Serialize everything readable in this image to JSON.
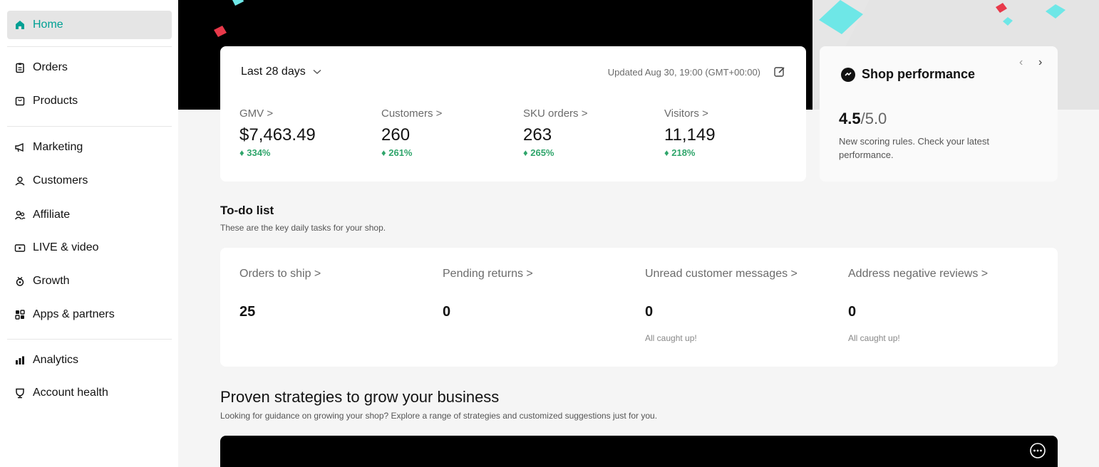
{
  "sidebar": {
    "items": [
      {
        "label": "Home",
        "icon": "home-icon"
      },
      {
        "label": "Orders",
        "icon": "orders-icon"
      },
      {
        "label": "Products",
        "icon": "products-icon"
      },
      {
        "label": "Marketing",
        "icon": "megaphone-icon"
      },
      {
        "label": "Customers",
        "icon": "customers-icon"
      },
      {
        "label": "Affiliate",
        "icon": "affiliate-icon"
      },
      {
        "label": "LIVE & video",
        "icon": "live-video-icon"
      },
      {
        "label": "Growth",
        "icon": "growth-icon"
      },
      {
        "label": "Apps & partners",
        "icon": "apps-icon"
      },
      {
        "label": "Analytics",
        "icon": "analytics-icon"
      },
      {
        "label": "Account health",
        "icon": "account-health-icon"
      }
    ]
  },
  "kpi": {
    "range": "Last 28 days",
    "updated": "Updated Aug 30, 19:00 (GMT+00:00)",
    "metrics": [
      {
        "label": "GMV >",
        "value": "$7,463.49",
        "change": "♦ 334%"
      },
      {
        "label": "Customers >",
        "value": "260",
        "change": "♦ 261%"
      },
      {
        "label": "SKU orders >",
        "value": "263",
        "change": "♦ 265%"
      },
      {
        "label": "Visitors >",
        "value": "11,149",
        "change": "♦ 218%"
      }
    ]
  },
  "performance": {
    "title": "Shop performance",
    "score": "4.5",
    "max": "/5.0",
    "description": "New scoring rules. Check your latest performance.",
    "prev": "‹",
    "next": "›"
  },
  "todo": {
    "title": "To-do list",
    "subtitle": "These are the key daily tasks for your shop.",
    "items": [
      {
        "label": "Orders to ship >",
        "value": "25",
        "note": ""
      },
      {
        "label": "Pending returns >",
        "value": "0",
        "note": ""
      },
      {
        "label": "Unread customer messages >",
        "value": "0",
        "note": "All caught up!"
      },
      {
        "label": "Address negative reviews >",
        "value": "0",
        "note": "All caught up!"
      }
    ]
  },
  "strategies": {
    "title": "Proven strategies to grow your business",
    "subtitle": "Looking for guidance on growing your shop? Explore a range of strategies and customized suggestions just for you."
  },
  "colors": {
    "accent": "#00a094",
    "positive": "#2fa56b",
    "confetti_cyan": "#6ee7e7",
    "confetti_red": "#e8394a"
  }
}
